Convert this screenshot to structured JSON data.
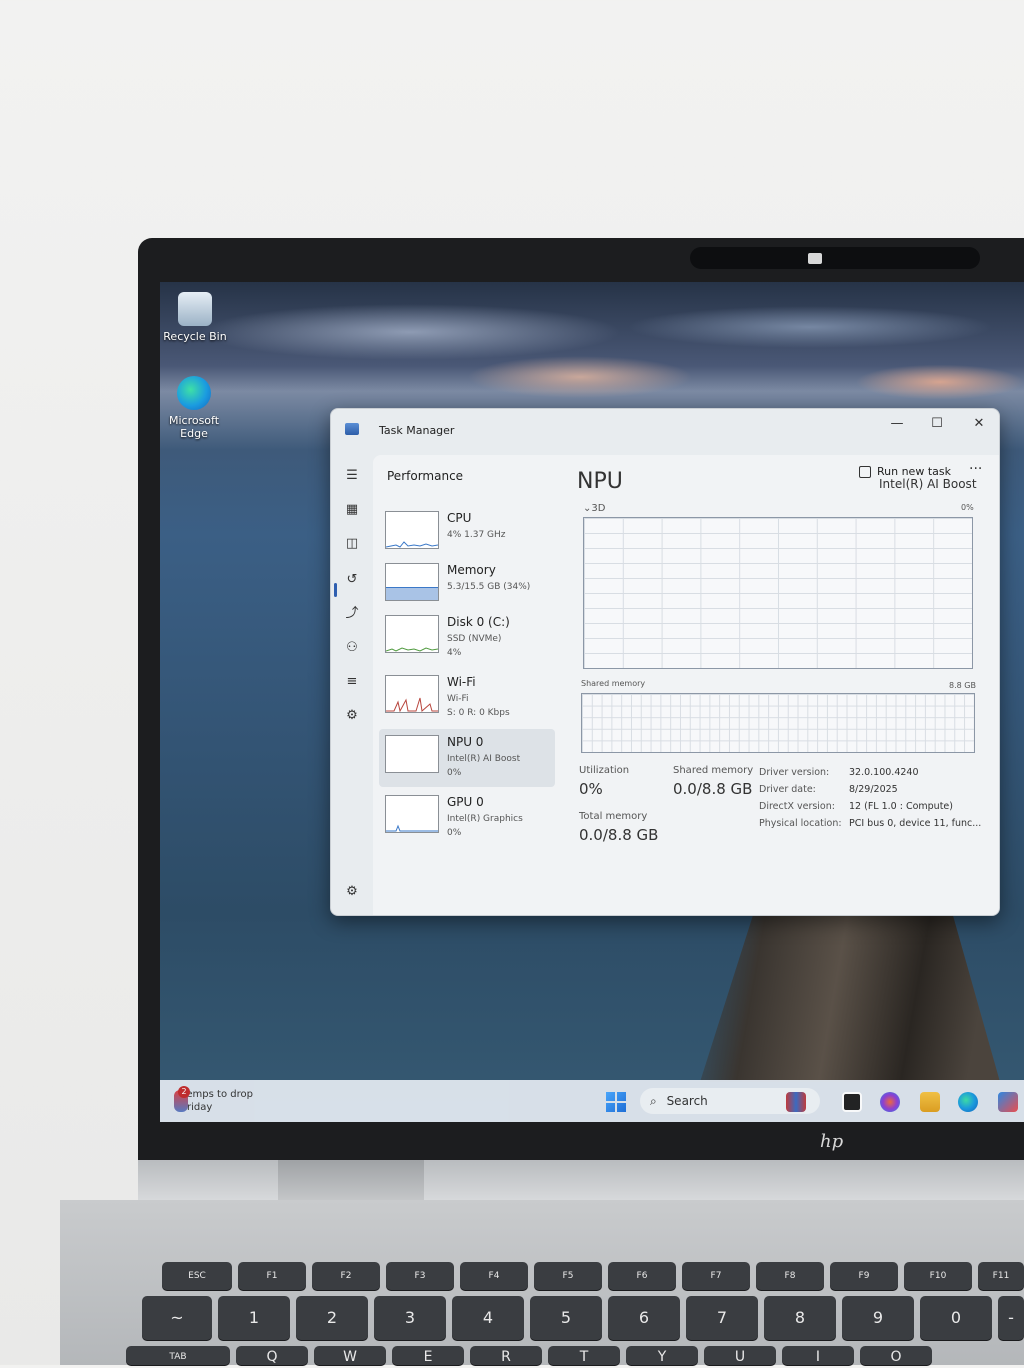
{
  "desktop": {
    "icons": [
      {
        "label": "Recycle Bin"
      },
      {
        "label": "Microsoft Edge"
      }
    ]
  },
  "task_manager": {
    "title": "Task Manager",
    "window_buttons": {
      "minimize": "—",
      "maximize": "☐",
      "close": "✕"
    },
    "header": {
      "title": "Performance",
      "run_new_task": "Run new task",
      "more": "···"
    },
    "sidebar": [
      {
        "title": "CPU",
        "lines": [
          "4% 1.37 GHz"
        ]
      },
      {
        "title": "Memory",
        "lines": [
          "5.3/15.5 GB (34%)"
        ]
      },
      {
        "title": "Disk 0 (C:)",
        "lines": [
          "SSD (NVMe)",
          "4%"
        ]
      },
      {
        "title": "Wi-Fi",
        "lines": [
          "Wi-Fi",
          "S: 0 R: 0 Kbps"
        ]
      },
      {
        "title": "NPU 0",
        "lines": [
          "Intel(R) AI Boost",
          "0%"
        ]
      },
      {
        "title": "GPU 0",
        "lines": [
          "Intel(R) Graphics",
          "0%"
        ]
      }
    ],
    "detail": {
      "heading": "NPU",
      "device": "Intel(R) AI Boost",
      "engine": "3D",
      "engine_pct": "0%",
      "shared_memory_label": "Shared memory",
      "shared_memory_max": "8.8 GB",
      "utilization_label": "Utilization",
      "utilization_value": "0%",
      "shared_mem_stat_label": "Shared memory",
      "shared_mem_stat_value": "0.0/8.8 GB",
      "total_memory_label": "Total memory",
      "total_memory_value": "0.0/8.8 GB",
      "properties": [
        {
          "key": "Driver version:",
          "value": "32.0.100.4240"
        },
        {
          "key": "Driver date:",
          "value": "8/29/2025"
        },
        {
          "key": "DirectX version:",
          "value": "12 (FL 1.0 : Compute)"
        },
        {
          "key": "Physical location:",
          "value": "PCI bus 0, device 11, func..."
        }
      ]
    }
  },
  "taskbar": {
    "weather_badge": "2",
    "weather_line1": "Temps to drop",
    "weather_line2": "Friday",
    "search_placeholder": "Search",
    "search_icon": "⌕"
  },
  "laptop": {
    "logo": "hp",
    "keys_fn": [
      "ESC",
      "F1",
      "F2",
      "F3",
      "F4",
      "F5",
      "F6",
      "F7",
      "F8",
      "F9",
      "F10",
      "F11"
    ],
    "keys_num": [
      "~",
      "1",
      "2",
      "3",
      "4",
      "5",
      "6",
      "7",
      "8",
      "9",
      "0",
      "-"
    ],
    "keys_row3": [
      "TAB",
      "Q",
      "W",
      "E",
      "R",
      "T",
      "Y",
      "U",
      "I",
      "O"
    ]
  }
}
